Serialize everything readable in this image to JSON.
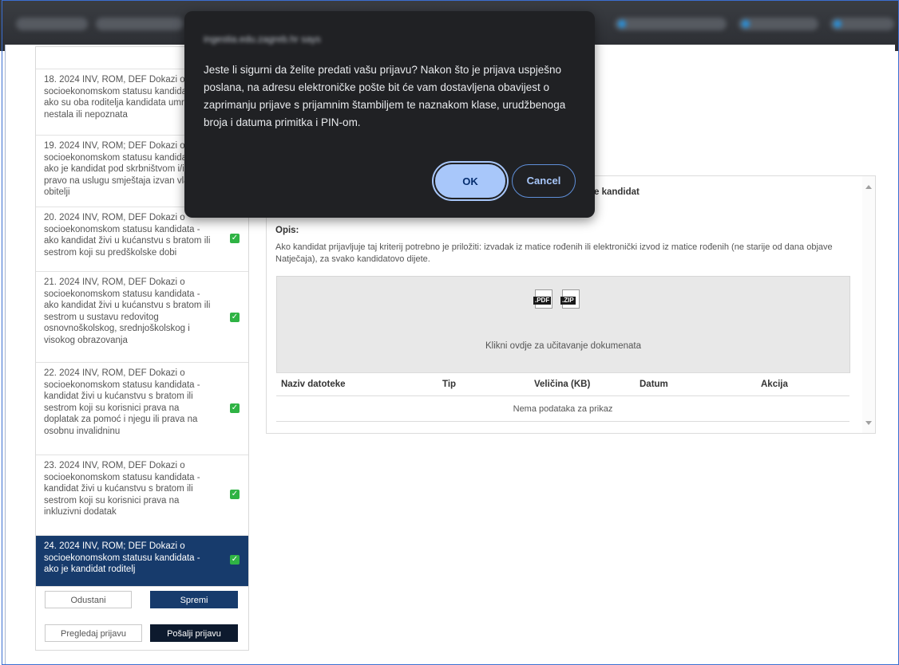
{
  "dialog": {
    "origin": "ingestia.edu.zagreb.hr says",
    "message": "Jeste li sigurni da želite predati vašu prijavu? Nakon što je prijava uspješno poslana, na adresu elektroničke pošte bit će vam dostavljena obavijest o zaprimanju prijave s prijamnim štambiljem te naznakom klase, urudžbenoga broja i datuma primitka i PIN-om.",
    "ok_label": "OK",
    "cancel_label": "Cancel"
  },
  "left_list": {
    "items": [
      {
        "label": "18. 2024 INV, ROM, DEF Dokazi o socioekonomskom statusu kandidata - ako su oba roditelja kandidata umrla, nestala ili nepoznata",
        "checked": true
      },
      {
        "label": "19. 2024 INV, ROM; DEF Dokazi o socioekonomskom statusu kandidata - ako je kandidat pod skrbništvom i/ili koristi pravo na uslugu smještaja izvan vlastite obitelji",
        "checked": true
      },
      {
        "label": "20. 2024 INV, ROM, DEF Dokazi o socioekonomskom statusu kandidata - ako kandidat živi u kućanstvu s bratom ili sestrom koji su predškolske dobi",
        "checked": true
      },
      {
        "label": "21. 2024 INV, ROM, DEF Dokazi o socioekonomskom statusu kandidata - ako kandidat živi u kućanstvu s bratom ili sestrom u sustavu redovitog osnovnoškolskog, srednjoškolskog i visokog obrazovanja",
        "checked": true
      },
      {
        "label": "22. 2024 INV, ROM, DEF Dokazi o socioekonomskom statusu kandidata - kandidat živi u kućanstvu s bratom ili sestrom koji su korisnici prava na doplatak za pomoć i njegu ili prava na osobnu invalidninu",
        "checked": true
      },
      {
        "label": "23. 2024 INV, ROM, DEF Dokazi o socioekonomskom statusu kandidata - kandidat živi u kućanstvu s bratom ili sestrom koji su korisnici prava na inkluzivni dodatak",
        "checked": true
      },
      {
        "label": "24. 2024 INV, ROM; DEF Dokazi o socioekonomskom statusu kandidata - ako je kandidat roditelj",
        "checked": true
      }
    ],
    "buttons": {
      "cancel": "Odustani",
      "save": "Spremi",
      "preview": "Pregledaj prijavu",
      "submit": "Pošalji prijavu"
    }
  },
  "detail": {
    "title_fragment": "e kandidat",
    "opis_label": "Opis:",
    "opis_text": "Ako kandidat prijavljuje taj kriterij potrebno je priložiti: izvadak iz matice rođenih ili elektronički izvod iz matice rođenih (ne starije od dana objave Natječaja), za svako kandidatovo dijete.",
    "file_tags": [
      ".PDF",
      ".ZIP"
    ],
    "upload_text": "Klikni ovdje za učitavanje dokumenata",
    "table": {
      "headers": [
        "Naziv datoteke",
        "Tip",
        "Veličina (KB)",
        "Datum",
        "Akcija"
      ],
      "empty_text": "Nema podataka za prikaz"
    }
  },
  "colors": {
    "active_item": "#173b6c",
    "check_green": "#2fb344",
    "dialog_bg": "#202124",
    "dialog_accent": "#a8c7fa"
  }
}
